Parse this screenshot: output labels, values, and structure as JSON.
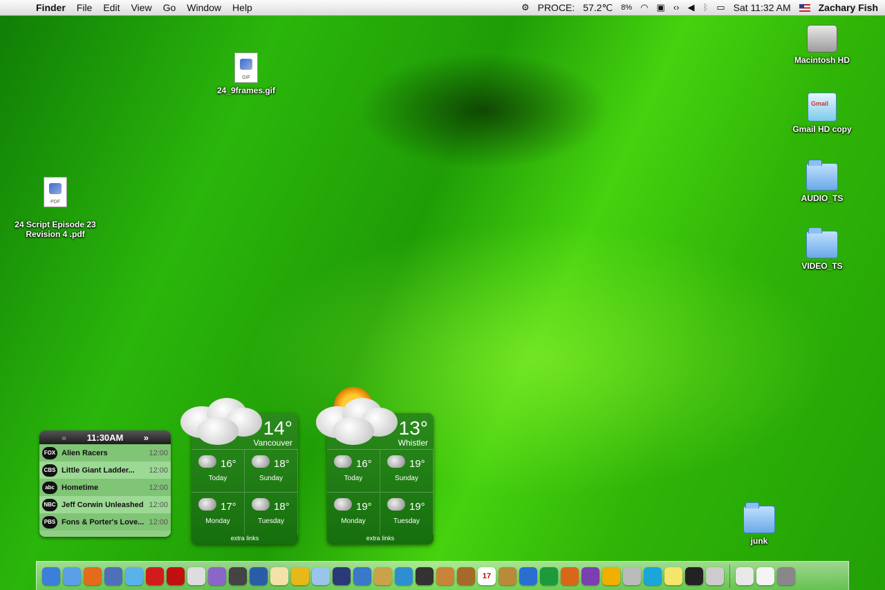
{
  "menubar": {
    "app_name": "Finder",
    "menus": [
      "File",
      "Edit",
      "View",
      "Go",
      "Window",
      "Help"
    ],
    "cpu_label": "PROCE:",
    "cpu_temp": "57.2℃",
    "battery_pct": "8%",
    "clock": "Sat 11:32 AM",
    "user": "Zachary Fish"
  },
  "desktop": {
    "icons": [
      {
        "label": "24_9frames.gif",
        "type": "GIF"
      },
      {
        "label": "24 Script Episode 23\nRevision 4 .pdf",
        "type": "PDF"
      },
      {
        "label": "Macintosh HD"
      },
      {
        "label": "Gmail HD copy"
      },
      {
        "label": "AUDIO_TS"
      },
      {
        "label": "VIDEO_TS"
      },
      {
        "label": "junk"
      }
    ]
  },
  "tv_widget": {
    "time": "11:30AM",
    "rows": [
      {
        "channel": "FOX",
        "title": "Alien Racers",
        "time": "12:00"
      },
      {
        "channel": "CBS",
        "title": "Little Giant Ladder...",
        "time": "12:00"
      },
      {
        "channel": "abc",
        "title": "Hometime",
        "time": "12:00"
      },
      {
        "channel": "NBC",
        "title": "Jeff Corwin Unleashed",
        "time": "12:00"
      },
      {
        "channel": "PBS",
        "title": "Fons & Porter's Love...",
        "time": "12:00"
      }
    ]
  },
  "weather": [
    {
      "temp": "14°",
      "city": "Vancouver",
      "days": [
        {
          "deg": "16°",
          "day": "Today"
        },
        {
          "deg": "18°",
          "day": "Sunday"
        },
        {
          "deg": "17°",
          "day": "Monday"
        },
        {
          "deg": "18°",
          "day": "Tuesday"
        }
      ],
      "links": "extra links"
    },
    {
      "temp": "13°",
      "city": "Whistler",
      "days": [
        {
          "deg": "16°",
          "day": "Today"
        },
        {
          "deg": "19°",
          "day": "Sunday"
        },
        {
          "deg": "19°",
          "day": "Monday"
        },
        {
          "deg": "19°",
          "day": "Tuesday"
        }
      ],
      "links": "extra links"
    }
  ],
  "dock": {
    "icons": [
      "Finder",
      "Safari",
      "Firefox",
      "Xcode",
      "iChat",
      "Scan",
      "Acrobat",
      "Chess",
      "DVD Player",
      "iMovie",
      "iDVD",
      "Preview",
      "iPhoto",
      "iTunes",
      "Final Cut",
      "QuickTime",
      "Photo Booth",
      "Network",
      "Hat",
      "GarageBand",
      "Hammer",
      "iCal",
      "Address Book",
      "Word",
      "Excel",
      "PowerPoint",
      "Entourage",
      "Sign",
      "System Prefs",
      "Sync",
      "Stickies",
      "Terminal",
      "Utility",
      "Mail",
      "Documents",
      "Trash"
    ],
    "ical_day": "17"
  }
}
